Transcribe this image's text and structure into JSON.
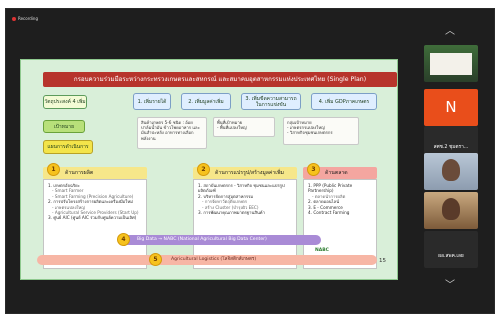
{
  "recording": {
    "label": "Recording"
  },
  "slide": {
    "title": "กรอบความร่วมมือระหว่างกระทรวงเกษตรและสหกรณ์ และสมาคมอุตสาหกรรมแห่งประเทศไทย (Single Plan)",
    "objective_label": "วัตถุประสงค์ 4 เพิ่ม",
    "objectives": [
      "1. เพิ่มรายได้",
      "2. เพิ่มมูลค่าเพิ่ม",
      "3. เพิ่มขีดความสามารถในการแข่งขัน",
      "4. เพิ่ม GDPภาคเกษตร"
    ],
    "goal_label": "เป้าหมาย",
    "goal_products": "สินค้าเกษตร 5-6 ชนิด : อ้อย ปาล์มน้ำมัน ข้าวโพดอาหาร และมันสำปะหลัง อาหารทางเลือก พลังงาน",
    "goal_area": "พื้นที่เป้าหมาย\n- พื้นที่แปลงใหญ่",
    "goal_group": "กลุ่มเป้าหมาย\n- เกษตรกรแปลงใหญ่\n- วิสาหกิจชุมชนเกษตรกร",
    "plan_label": "แผนการดำเนินการ",
    "columns": [
      {
        "number": "1",
        "heading": "ด้านการผลิต",
        "items": [
          "1. เกษตรอัจฉริยะ",
          "- Smart Farmer",
          "- Smart Farming (Precision Agriculture)",
          "2. การปรับโครงสร้างการผลิตและเครื่องมือใหม่",
          "- เกษตรแปลงใหญ่",
          "- Agricultural Service Providers (Start Up)",
          "3. ศูนย์ AIC (ศูนย์ AIC ร่วมกับศูนย์ความเป็นเลิศ)"
        ]
      },
      {
        "number": "2",
        "heading": "ด้านการแปรรูป/สร้างมูลค่าเพิ่ม",
        "items": [
          "1. สถาบันเกษตรกร - วิสาหกิจ ชุมชนและแปรรูปผลิตภัณฑ์",
          "2. บริหารจัดการสู่อุตสาหกรรม",
          "- การจัดหาวัตถุดิบเกษตร",
          "- สร้าง Cluster (บำรุงผิว EEC)",
          "3. การพัฒนาคุณภาพมาตรฐานสินค้า"
        ]
      },
      {
        "number": "3",
        "heading": "ด้านตลาด",
        "items": [
          "1. PPP (Public Private Partnership)",
          "- ตลาดนำการผลิต",
          "2. ตลาดออนไลน์",
          "3. E - Commerce",
          "4. Contract Farming"
        ]
      }
    ],
    "bar4": {
      "number": "4",
      "text": "Big Data  →  NABC (National Agricultural Big Data Center)"
    },
    "bar5": {
      "number": "5",
      "text": "Agricultural Logistics (โลจิสติกส์เกษตร)"
    },
    "logo_text": "NABC",
    "page_number": "15"
  },
  "participants": [
    {
      "name": "",
      "initial": ""
    },
    {
      "name": "",
      "initial": "N"
    },
    {
      "name": "สศช.2 ชุมตรา...",
      "initial": ""
    },
    {
      "name": "",
      "initial": ""
    },
    {
      "name": "",
      "initial": ""
    },
    {
      "name": "ผอ.สพค.เลย",
      "initial": ""
    }
  ],
  "colors": {
    "title_bg": "#b7342c",
    "slide_bg": "#d9efd9",
    "avatar_n": "#e94e1b",
    "bar4": "#c9b7e8",
    "bar5": "#f8b9a9"
  }
}
